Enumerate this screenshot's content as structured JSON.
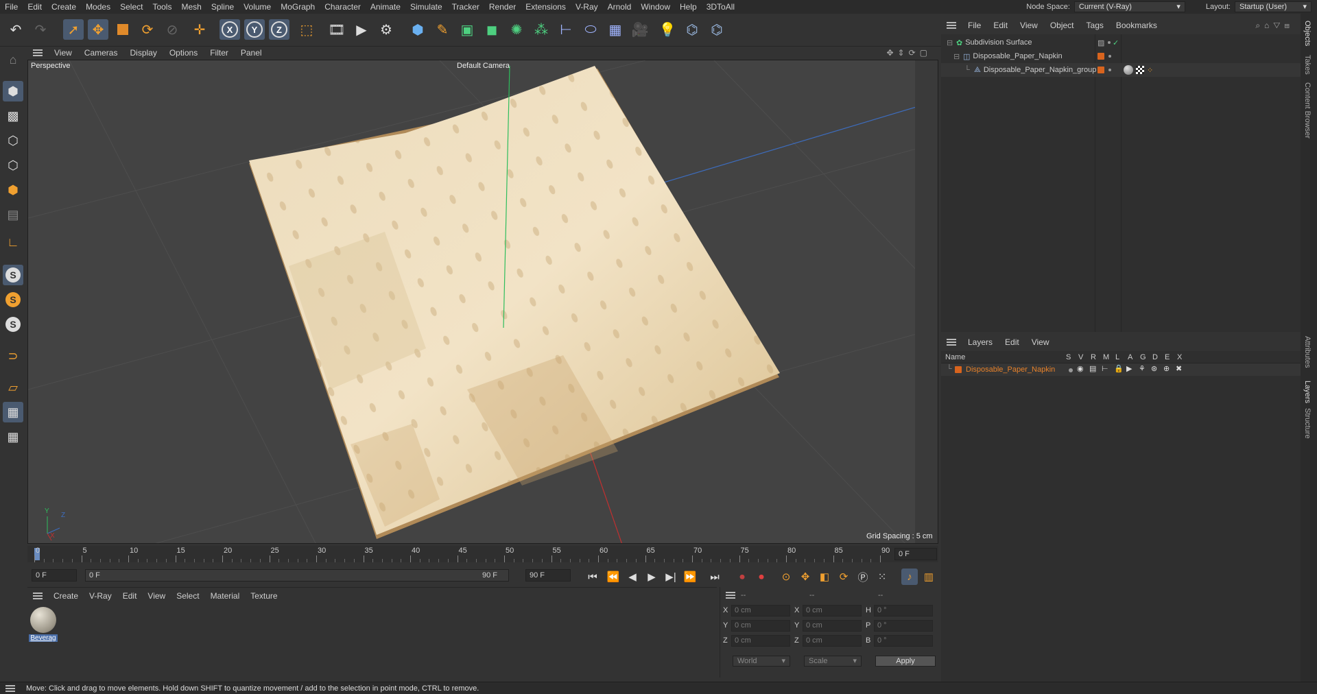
{
  "menubar": {
    "items": [
      "File",
      "Edit",
      "Create",
      "Modes",
      "Select",
      "Tools",
      "Mesh",
      "Spline",
      "Volume",
      "MoGraph",
      "Character",
      "Animate",
      "Simulate",
      "Tracker",
      "Render",
      "Extensions",
      "V-Ray",
      "Arnold",
      "Window",
      "Help",
      "3DToAll"
    ],
    "node_space_label": "Node Space:",
    "node_space_value": "Current (V-Ray)",
    "layout_label": "Layout:",
    "layout_value": "Startup (User)"
  },
  "viewport": {
    "menu": [
      "View",
      "Cameras",
      "Display",
      "Options",
      "Filter",
      "Panel"
    ],
    "view_name": "Perspective",
    "camera_name": "Default Camera",
    "grid_spacing": "Grid Spacing : 5 cm",
    "axis_labels": {
      "y": "Y",
      "z": "Z",
      "x": "X"
    }
  },
  "timeline": {
    "ticks": [
      "0",
      "5",
      "10",
      "15",
      "20",
      "25",
      "30",
      "35",
      "40",
      "45",
      "50",
      "55",
      "60",
      "65",
      "70",
      "75",
      "80",
      "85",
      "90"
    ],
    "current_frame": "0 F"
  },
  "transport": {
    "start_field": "0 F",
    "range_start": "0 F",
    "range_end": "90 F",
    "end_field": "90 F"
  },
  "material_manager": {
    "menu": [
      "Create",
      "V-Ray",
      "Edit",
      "View",
      "Select",
      "Material",
      "Texture"
    ],
    "material_name": "Beverag"
  },
  "coordinates": {
    "header": [
      "--",
      "--",
      "--"
    ],
    "rows": [
      {
        "l1": "X",
        "v1": "0 cm",
        "l2": "X",
        "v2": "0 cm",
        "l3": "H",
        "v3": "0 °"
      },
      {
        "l1": "Y",
        "v1": "0 cm",
        "l2": "Y",
        "v2": "0 cm",
        "l3": "P",
        "v3": "0 °"
      },
      {
        "l1": "Z",
        "v1": "0 cm",
        "l2": "Z",
        "v2": "0 cm",
        "l3": "B",
        "v3": "0 °"
      }
    ],
    "space": "World",
    "mode": "Scale",
    "apply_label": "Apply"
  },
  "object_manager": {
    "menu": [
      "File",
      "Edit",
      "View",
      "Object",
      "Tags",
      "Bookmarks"
    ],
    "objects": [
      {
        "name": "Subdivision Surface",
        "indent": 0
      },
      {
        "name": "Disposable_Paper_Napkin",
        "indent": 1
      },
      {
        "name": "Disposable_Paper_Napkin_group",
        "indent": 2
      }
    ]
  },
  "layer_manager": {
    "menu": [
      "Layers",
      "Edit",
      "View"
    ],
    "columns": [
      "Name",
      "S",
      "V",
      "R",
      "M",
      "L",
      "A",
      "G",
      "D",
      "E",
      "X"
    ],
    "layers": [
      {
        "name": "Disposable_Paper_Napkin",
        "color": "#d8641e"
      }
    ]
  },
  "right_tabs": [
    "Objects",
    "Takes",
    "Content Browser",
    "Attributes",
    "Layers",
    "Structure"
  ],
  "status": "Move: Click and drag to move elements. Hold down SHIFT to quantize movement / add to the selection in point mode, CTRL to remove.",
  "colors": {
    "accent": "#f0a030",
    "layer_text": "#e8822a",
    "active_tool": "#4a5a70"
  }
}
